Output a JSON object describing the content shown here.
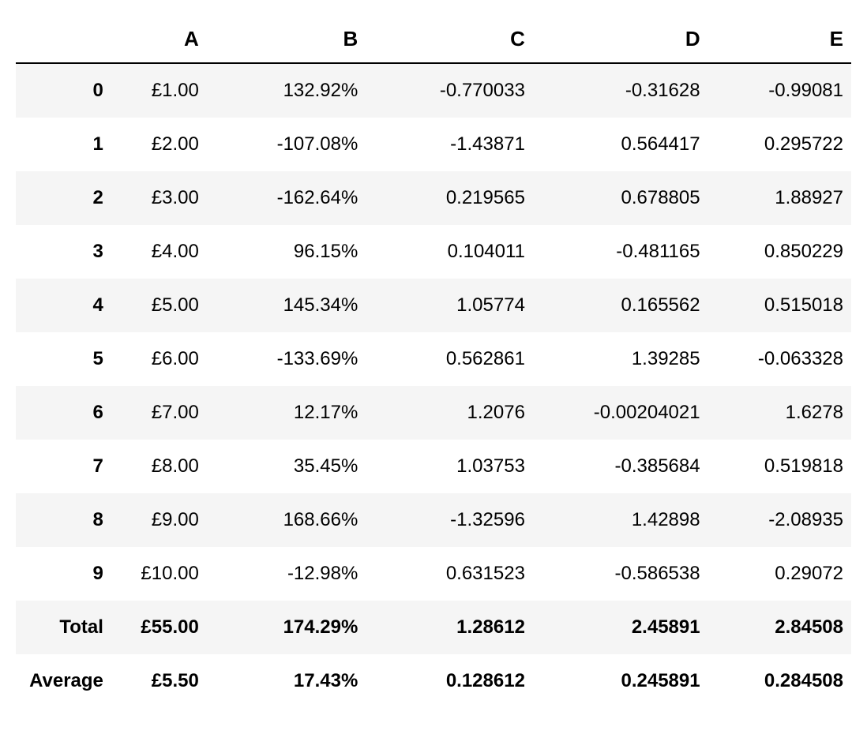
{
  "chart_data": {
    "type": "table",
    "columns": [
      "A",
      "B",
      "C",
      "D",
      "E"
    ],
    "rows": [
      {
        "idx": "0",
        "A": "£1.00",
        "B": "132.92%",
        "C": "-0.770033",
        "D": "-0.31628",
        "E": "-0.99081"
      },
      {
        "idx": "1",
        "A": "£2.00",
        "B": "-107.08%",
        "C": "-1.43871",
        "D": "0.564417",
        "E": "0.295722"
      },
      {
        "idx": "2",
        "A": "£3.00",
        "B": "-162.64%",
        "C": "0.219565",
        "D": "0.678805",
        "E": "1.88927"
      },
      {
        "idx": "3",
        "A": "£4.00",
        "B": "96.15%",
        "C": "0.104011",
        "D": "-0.481165",
        "E": "0.850229"
      },
      {
        "idx": "4",
        "A": "£5.00",
        "B": "145.34%",
        "C": "1.05774",
        "D": "0.165562",
        "E": "0.515018"
      },
      {
        "idx": "5",
        "A": "£6.00",
        "B": "-133.69%",
        "C": "0.562861",
        "D": "1.39285",
        "E": "-0.063328"
      },
      {
        "idx": "6",
        "A": "£7.00",
        "B": "12.17%",
        "C": "1.2076",
        "D": "-0.00204021",
        "E": "1.6278"
      },
      {
        "idx": "7",
        "A": "£8.00",
        "B": "35.45%",
        "C": "1.03753",
        "D": "-0.385684",
        "E": "0.519818"
      },
      {
        "idx": "8",
        "A": "£9.00",
        "B": "168.66%",
        "C": "-1.32596",
        "D": "1.42898",
        "E": "-2.08935"
      },
      {
        "idx": "9",
        "A": "£10.00",
        "B": "-12.98%",
        "C": "0.631523",
        "D": "-0.586538",
        "E": "0.29072"
      }
    ],
    "summary": [
      {
        "label": "Total",
        "A": "£55.00",
        "B": "174.29%",
        "C": "1.28612",
        "D": "2.45891",
        "E": "2.84508"
      },
      {
        "label": "Average",
        "A": "£5.50",
        "B": "17.43%",
        "C": "0.128612",
        "D": "0.245891",
        "E": "0.284508"
      }
    ]
  }
}
